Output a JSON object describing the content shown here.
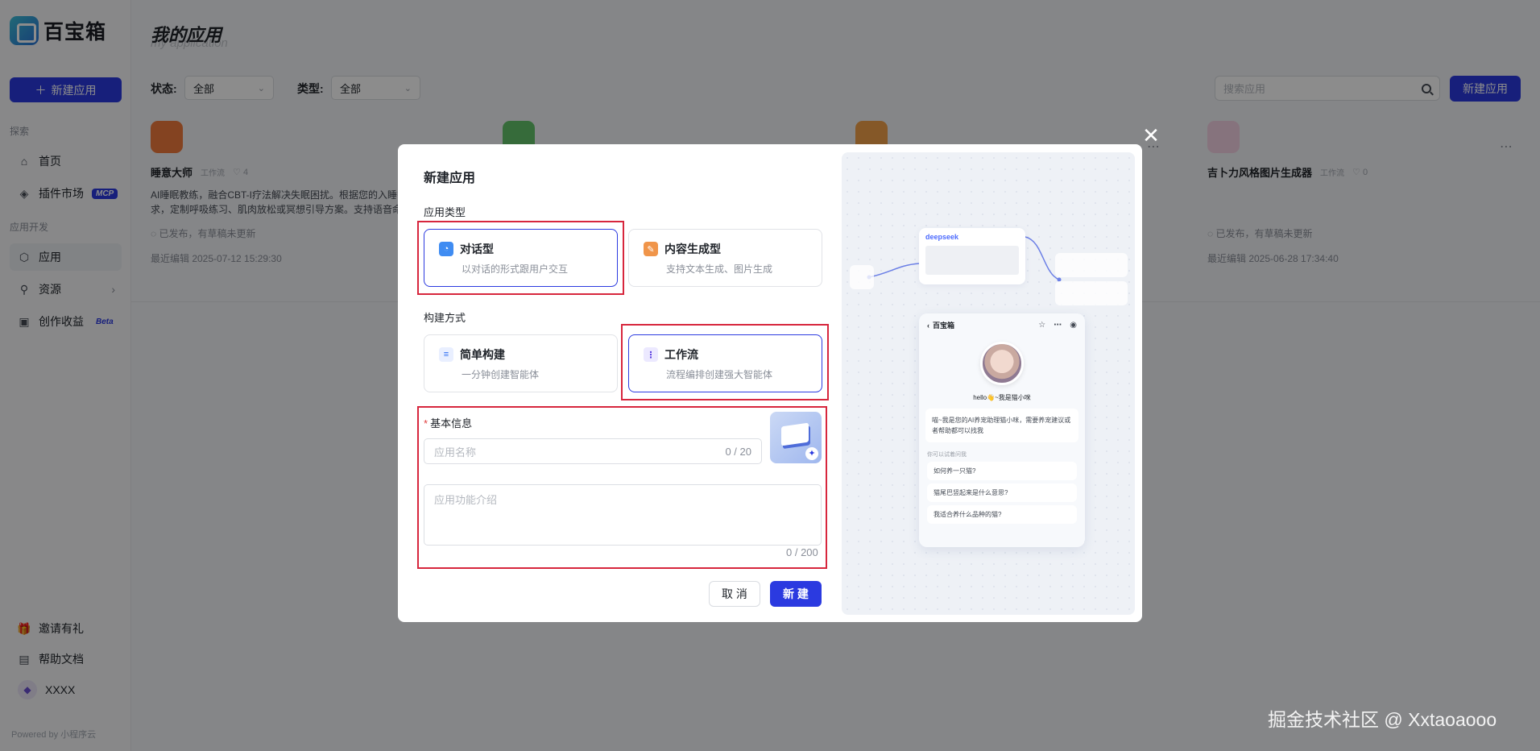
{
  "brand": {
    "name": "百宝箱"
  },
  "sidebar": {
    "new_app": "新建应用",
    "section_explore": "探索",
    "home": "首页",
    "plugin_market": "插件市场",
    "mcp_badge": "MCP",
    "section_dev": "应用开发",
    "apps": "应用",
    "resources": "资源",
    "creator_income": "创作收益",
    "beta_badge": "Beta",
    "invite": "邀请有礼",
    "help": "帮助文档",
    "user": "XXXX",
    "powered": "Powered by  小程序云"
  },
  "header": {
    "title": "我的应用",
    "subtitle": "my application",
    "status_label": "状态:",
    "status_value": "全部",
    "type_label": "类型:",
    "type_value": "全部",
    "search_placeholder": "搜索应用",
    "new_app": "新建应用"
  },
  "cards": [
    {
      "name": "睡意大师",
      "tag": "工作流",
      "likes": "4",
      "desc": "AI睡眠教练，融合CBT-I疗法解决失眠困扰。根据您的入睡需求，定制呼吸练习、肌肉放松或冥想引导方案。支持语音命",
      "status": "已发布，有草稿未更新",
      "edited": "最近编辑 2025-07-12 15:29:30"
    },
    {
      "name": "吉卜力风格图片生成器",
      "tag": "工作流",
      "likes": "0",
      "desc": "",
      "status": "已发布，有草稿未更新",
      "edited": "最近编辑 2025-06-28 17:34:40"
    }
  ],
  "modal": {
    "title": "新建应用",
    "type_label": "应用类型",
    "type_options": [
      {
        "name": "对话型",
        "desc": "以对话的形式跟用户交互",
        "selected": true
      },
      {
        "name": "内容生成型",
        "desc": "支持文本生成、图片生成",
        "selected": false
      }
    ],
    "build_label": "构建方式",
    "build_options": [
      {
        "name": "简单构建",
        "desc": "一分钟创建智能体",
        "selected": false
      },
      {
        "name": "工作流",
        "desc": "流程编排创建强大智能体",
        "selected": true
      }
    ],
    "basic_info_label": "基本信息",
    "name_placeholder": "应用名称",
    "name_counter": "0 / 20",
    "desc_placeholder": "应用功能介绍",
    "desc_counter": "0 / 200",
    "cancel": "取 消",
    "create": "新 建"
  },
  "preview": {
    "node_label": "deepseek",
    "app_name": "百宝箱",
    "hello": "hello👋~我是猫小咪",
    "intro": "喵~我是您的AI养宠助理猫小咪，需要养宠建议或者帮助都可以找我",
    "tip": "你可以试着问我",
    "questions": [
      "如何养一只猫?",
      "猫尾巴竖起来是什么意思?",
      "我适合养什么品种的猫?"
    ]
  },
  "watermark": "掘金技术社区 @ Xxtaoaooo",
  "colors": {
    "accent": "#2b3ae0",
    "highlight_border": "#d7263d"
  }
}
